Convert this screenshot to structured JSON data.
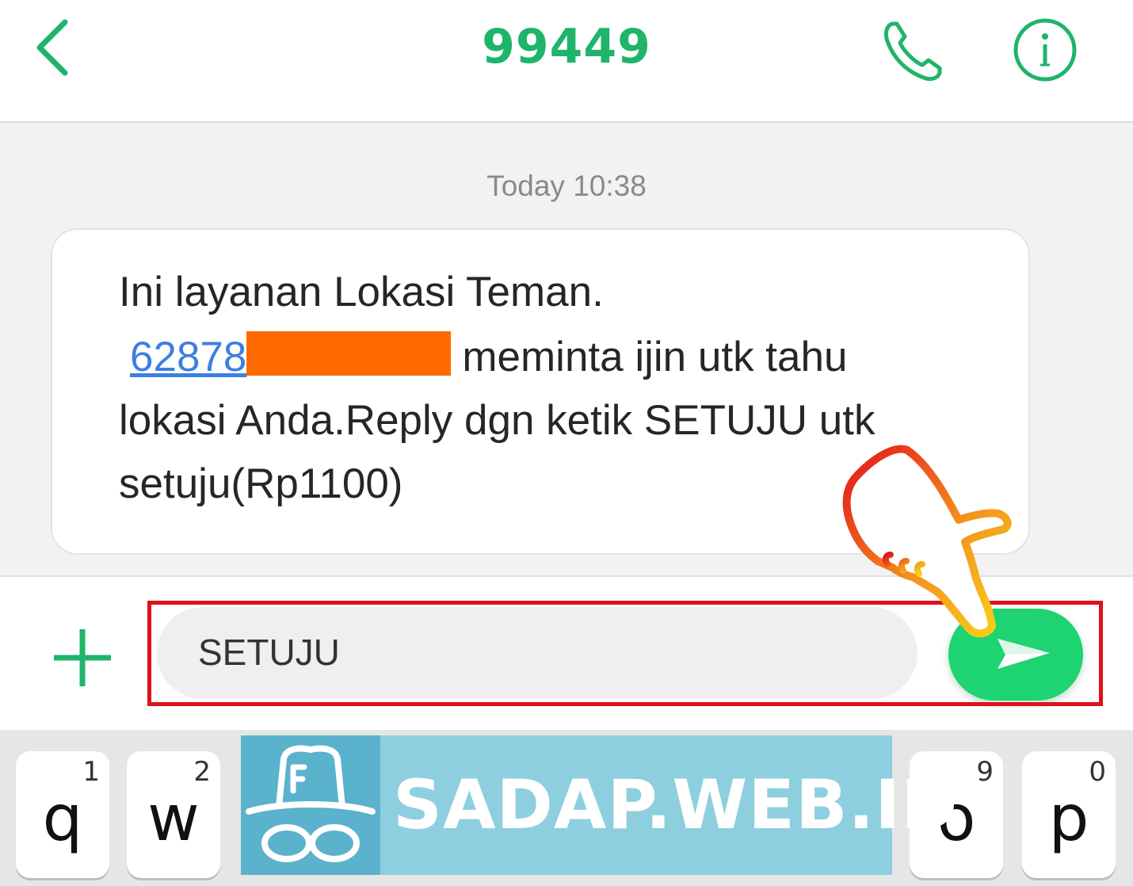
{
  "header": {
    "title": "99449",
    "back_icon": "chevron-left-icon",
    "call_icon": "phone-icon",
    "info_icon": "info-icon",
    "accent_color": "#1fb46a"
  },
  "conversation": {
    "timestamp": "Today 10:38",
    "message": {
      "line1": "Ini layanan Lokasi Teman.",
      "phone_link": "62878",
      "line2_rest": "meminta ijin utk tahu",
      "line3": "lokasi Anda.Reply dgn ketik SETUJU utk",
      "line4": "setuju(Rp1100)"
    }
  },
  "composer": {
    "input_value": "SETUJU",
    "add_icon": "plus-icon",
    "send_icon": "send-icon",
    "send_color": "#1ed371",
    "highlight_color": "#e0101a"
  },
  "keyboard": {
    "keys": [
      {
        "char": "q",
        "num": "1"
      },
      {
        "char": "w",
        "num": "2"
      },
      {
        "char": "o",
        "num": "9"
      },
      {
        "char": "p",
        "num": "0"
      }
    ]
  },
  "watermark": {
    "text": "SADAP.WEB.ID"
  }
}
